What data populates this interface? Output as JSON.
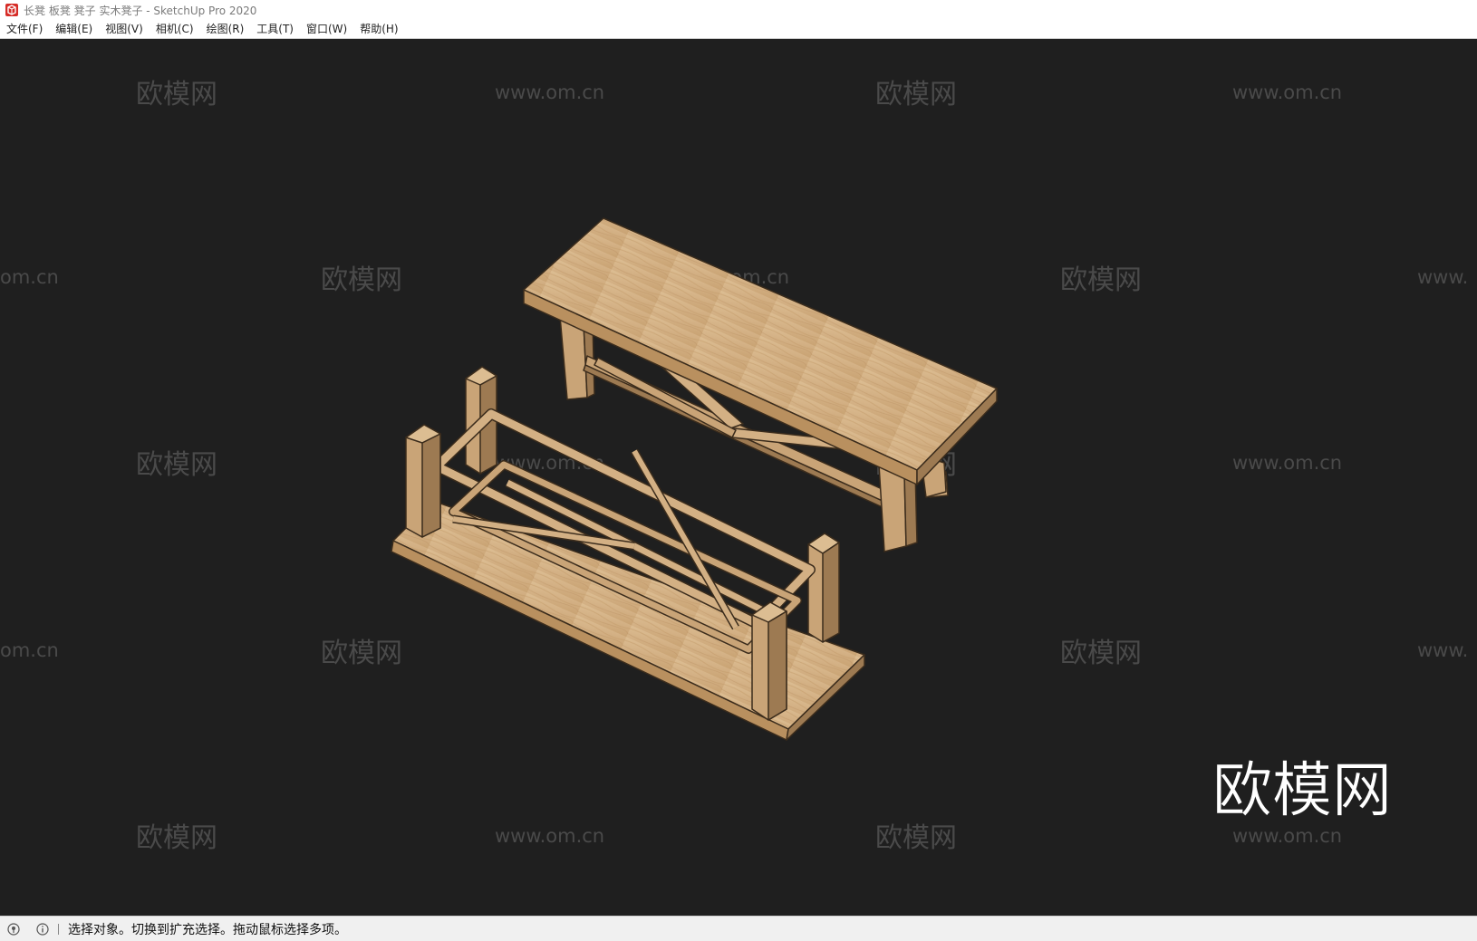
{
  "window": {
    "title": "长凳 板凳 凳子 实木凳子 - SketchUp Pro 2020"
  },
  "menu": {
    "items": [
      {
        "id": "file",
        "label": "文件(F)"
      },
      {
        "id": "edit",
        "label": "编辑(E)"
      },
      {
        "id": "view",
        "label": "视图(V)"
      },
      {
        "id": "camera",
        "label": "相机(C)"
      },
      {
        "id": "draw",
        "label": "绘图(R)"
      },
      {
        "id": "tools",
        "label": "工具(T)"
      },
      {
        "id": "window",
        "label": "窗口(W)"
      },
      {
        "id": "help",
        "label": "帮助(H)"
      }
    ]
  },
  "watermark": {
    "cn": "欧模网",
    "url": "www.om.cn",
    "url_cut_left": "om.cn",
    "url_cut_right": "www."
  },
  "logo": {
    "text": "欧模网"
  },
  "statusbar": {
    "text": "选择对象。切换到扩充选择。拖动鼠标选择多项。"
  },
  "icons": {
    "app": "sketchup-icon",
    "geo": "geo-location-icon",
    "info": "info-icon"
  },
  "colors": {
    "viewport_bg": "#1f1f1f",
    "wood_light": "#d9b88b",
    "wood_mid": "#c9a477",
    "wood_dark": "#9d7a52",
    "edge": "#3b2c1c",
    "watermark": "#4a4a4a"
  }
}
